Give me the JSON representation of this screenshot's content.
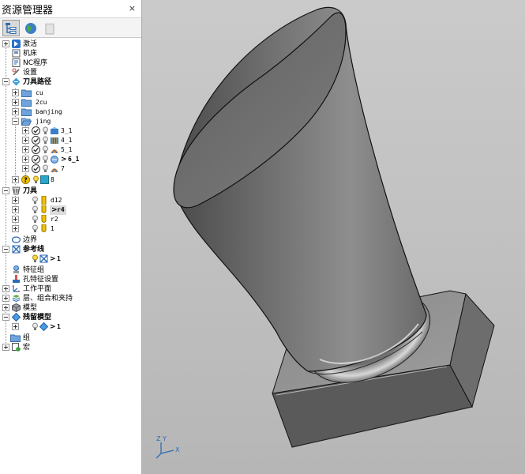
{
  "explorer": {
    "title": "资源管理器",
    "close": "×",
    "toolbar": [
      "explorer-tree-icon",
      "globe-icon",
      "trash-icon"
    ]
  },
  "tree": {
    "active": "激活",
    "machine": "机床",
    "nc": "NC程序",
    "settings": "设置",
    "toolpaths": "刀具路径",
    "tp_cu": "cu",
    "tp_2cu": "2cu",
    "tp_banjing": "banjing",
    "tp_jing": "jing",
    "tp_31": "3_1",
    "tp_41": "4_1",
    "tp_51": "5_1",
    "tp_61": "6_1",
    "tp_7": "7",
    "tp_8": "8",
    "tools": "刀具",
    "tool_d12": "d12",
    "tool_r4": "r4",
    "tool_r2": "r2",
    "tool_1": "1",
    "boundary": "边界",
    "reference": "参考线",
    "ref_1": "1",
    "feature_group": "特征组",
    "hole_settings": "孔特征设置",
    "workplane": "工作平面",
    "layers": "层、组合和夹持",
    "model": "模型",
    "stock": "残留模型",
    "stock_1": "1",
    "group": "组",
    "macro": "宏",
    "active_marker": ">"
  },
  "viewport": {
    "axis_z": "Z",
    "axis_y": "Y",
    "axis_x": "X"
  }
}
